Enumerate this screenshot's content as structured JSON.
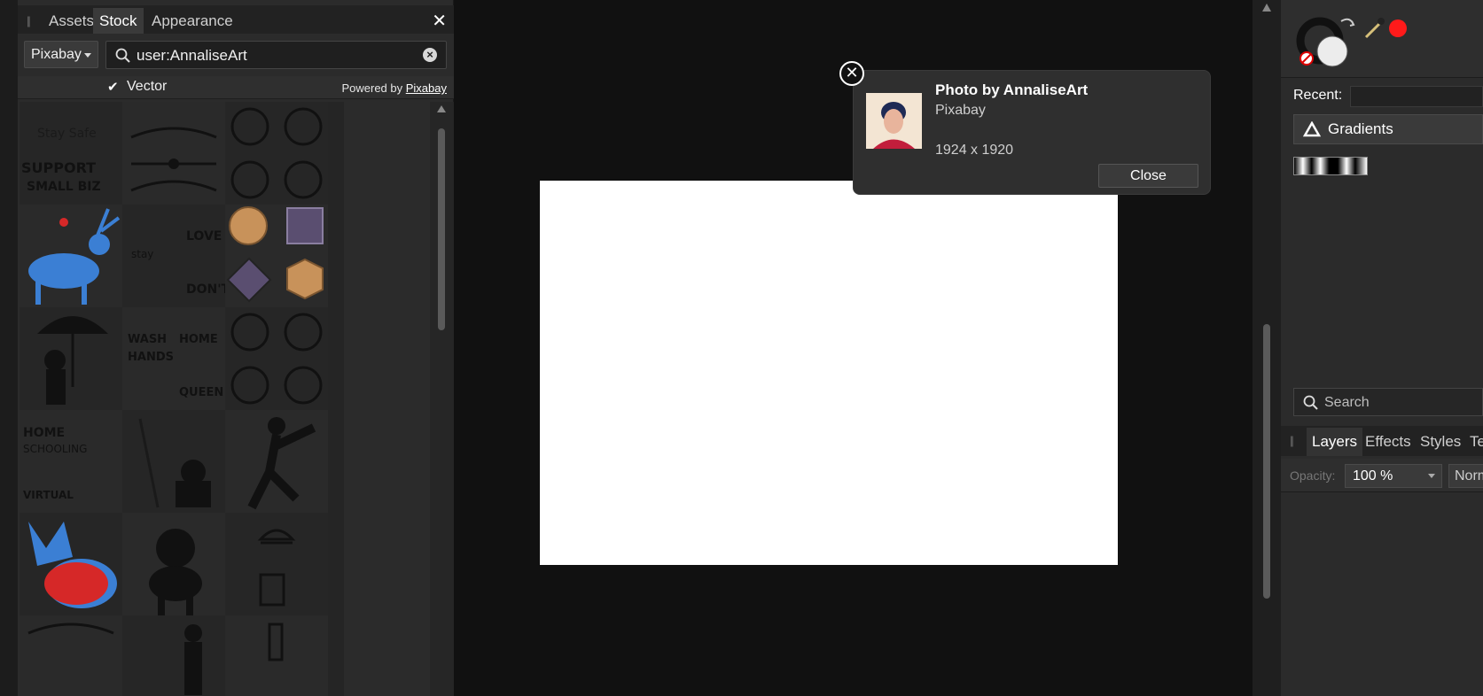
{
  "left_panel": {
    "tabs": [
      "Assets",
      "Stock",
      "Appearance"
    ],
    "active_tab": "Stock",
    "provider": "Pixabay",
    "search_value": "user:AnnaliseArt",
    "vector_label": "Vector",
    "vector_checked": true,
    "powered_prefix": "Powered by",
    "powered_link": "Pixabay"
  },
  "popup": {
    "title": "Photo by AnnaliseArt",
    "source": "Pixabay",
    "size": "1924 x 1920",
    "close_label": "Close"
  },
  "right_panel": {
    "recent_label": "Recent:",
    "gradients_label": "Gradients",
    "search_placeholder": "Search",
    "tabs": [
      "Layers",
      "Effects",
      "Styles",
      "Te"
    ],
    "active_tab": "Layers",
    "opacity_label": "Opacity:",
    "opacity_value": "100 %",
    "blend_value": "Norm"
  },
  "colors": {
    "background": "#111111",
    "panel": "#2b2b2b",
    "accent_red": "#ff1a1a",
    "sticker_blue": "#3b7fd4"
  }
}
